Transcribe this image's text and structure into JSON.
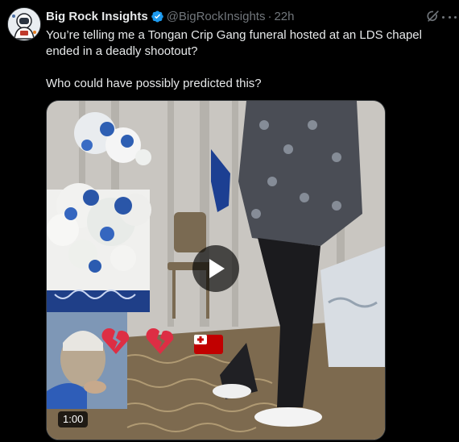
{
  "post": {
    "author_name": "Big Rock Insights",
    "handle": "@BigRockInsights",
    "separator": "·",
    "time": "22h",
    "text_line1": "You’re telling me a Tongan Crip Gang funeral hosted at an LDS chapel ended in a deadly shootout?",
    "text_line2": "Who could have possibly predicted this?"
  },
  "video": {
    "duration": "1:00",
    "overlay_emojis": [
      "broken-heart",
      "broken-heart",
      "tonga-flag"
    ]
  },
  "colors": {
    "background": "#000000",
    "text": "#e7e9ea",
    "muted": "#71767b",
    "verified": "#1d9bf0",
    "border": "#2f3336"
  },
  "icons": {
    "verified": "verified-badge-icon",
    "grok": "grok-icon",
    "more": "more-icon",
    "play": "play-icon"
  }
}
